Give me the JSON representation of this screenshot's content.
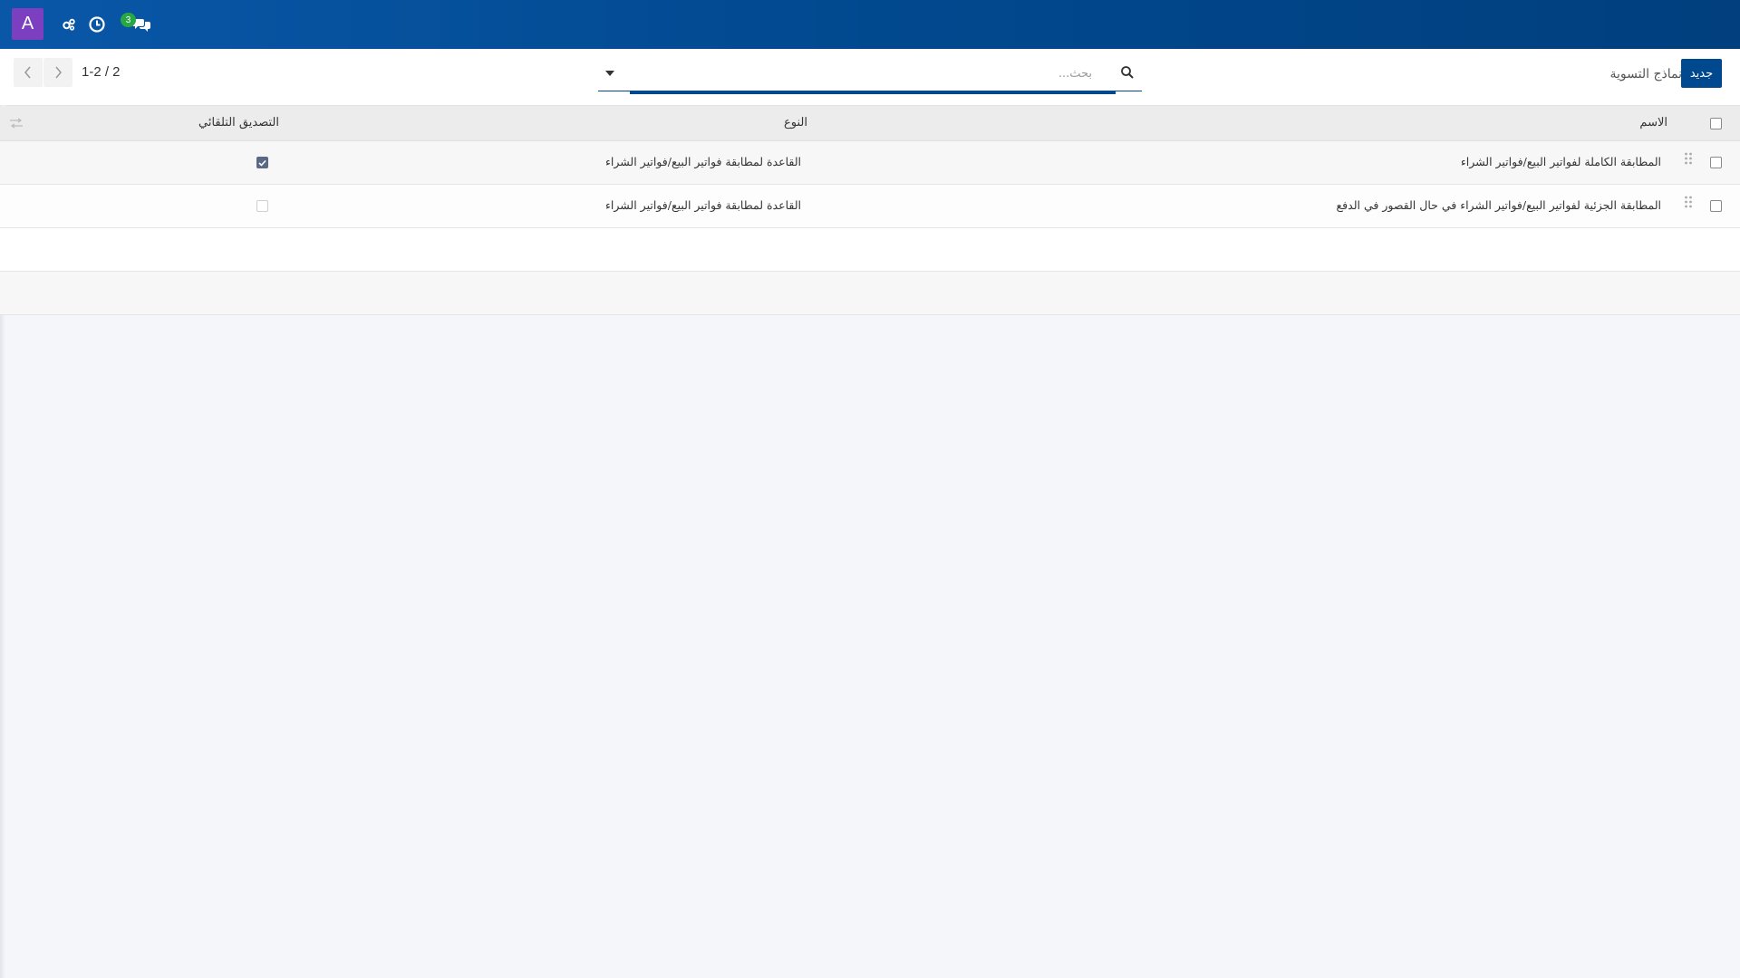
{
  "topbar": {
    "avatar_letter": "A",
    "messages_badge": "3",
    "icons": [
      "settings-cogs-icon",
      "clock-icon",
      "messages-icon"
    ]
  },
  "controlbar": {
    "new_button": "جديد",
    "breadcrumb": "نماذج التسوية",
    "search_placeholder": "بحث...",
    "pager_text": "1-2 / 2"
  },
  "table": {
    "headers": {
      "name": "الاسم",
      "type": "النوع",
      "auto_validate": "التصديق التلقائي"
    },
    "rows": [
      {
        "name": "المطابقة الكاملة لفواتير البيع/فواتير الشراء",
        "type": "القاعدة لمطابقة فواتير البيع/فواتير الشراء",
        "auto_validate": true
      },
      {
        "name": "المطابقة الجزئية لفواتير البيع/فواتير الشراء في حال القصور في الدفع",
        "type": "القاعدة لمطابقة فواتير البيع/فواتير الشراء",
        "auto_validate": false
      }
    ]
  },
  "colors": {
    "primary": "#01498f",
    "avatar": "#7b3fbf",
    "badge": "#28a745"
  }
}
